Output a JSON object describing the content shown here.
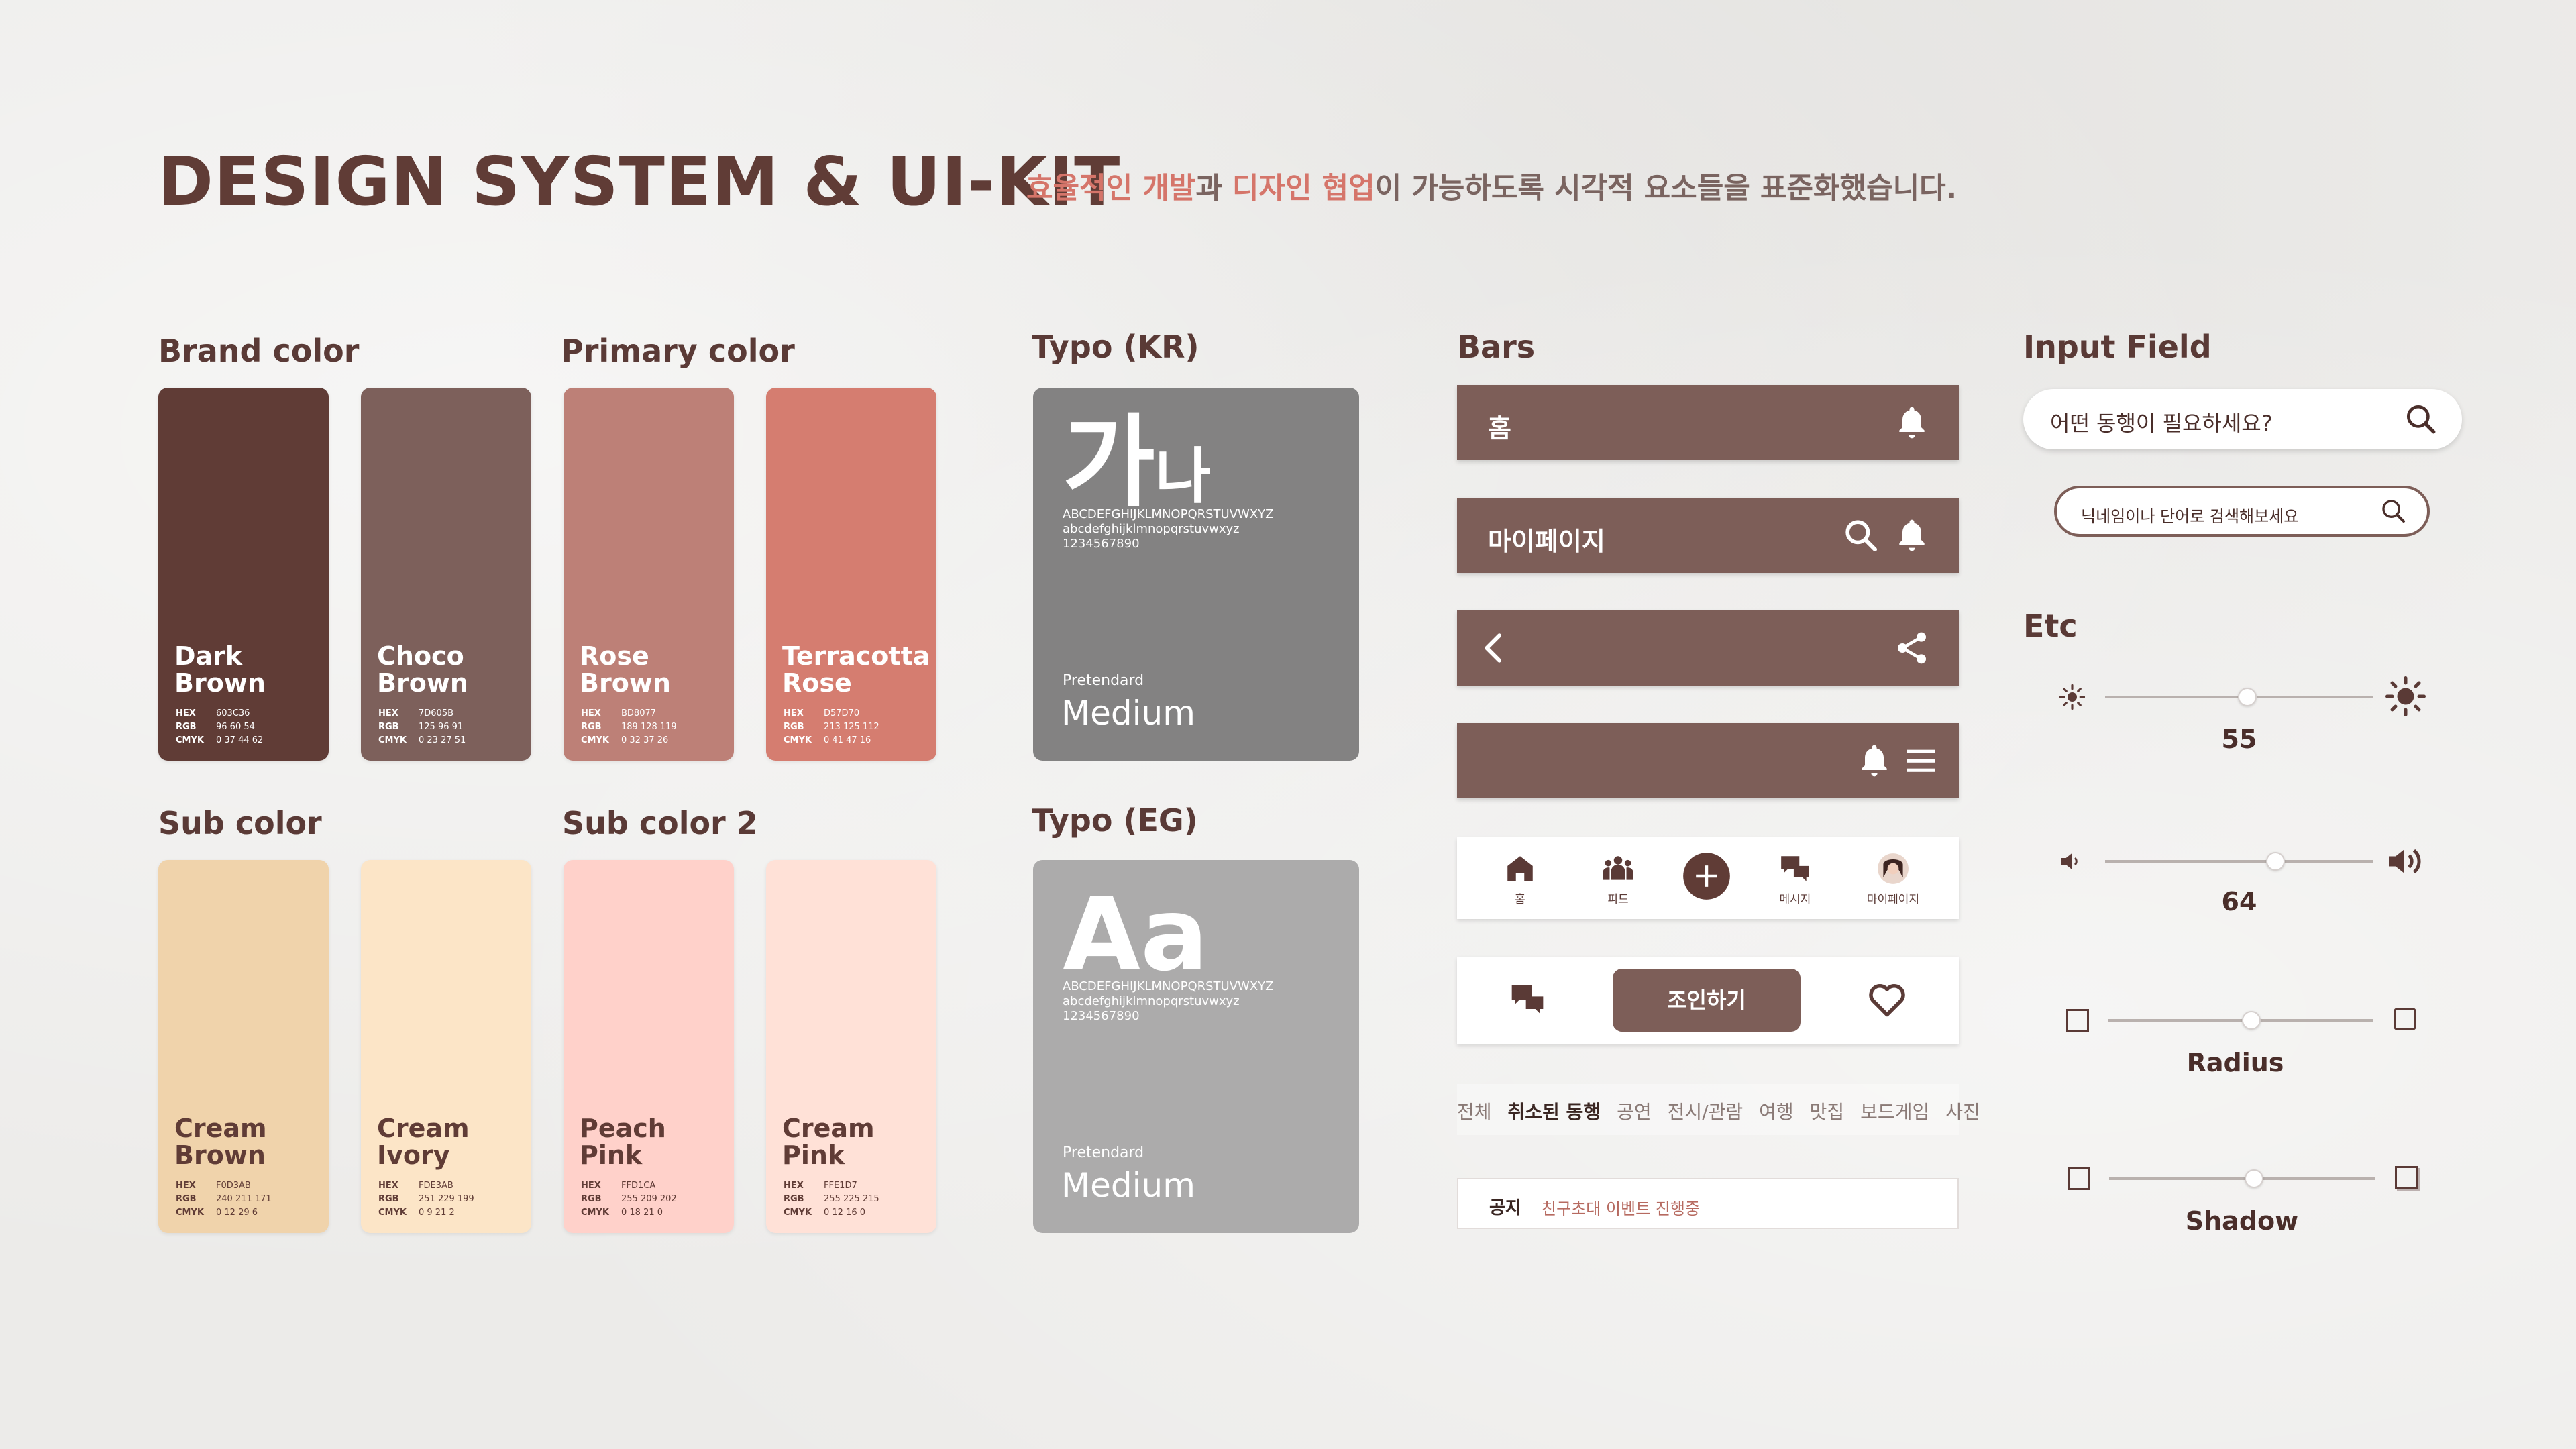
{
  "header": {
    "title": "DESIGN SYSTEM & UI-KIT",
    "tagline": {
      "hl1": "효율적인 개발",
      "t1": "과 ",
      "hl2": "디자인 협업",
      "t2": "이 가능하도록 시각적 요소들을 표준화했습니다."
    }
  },
  "colors": {
    "brand_label": "Brand color",
    "primary_label": "Primary color",
    "sub_label": "Sub color",
    "sub2_label": "Sub color 2",
    "swatches": [
      {
        "name": "Dark Brown",
        "hex": "603C36",
        "rgb": "96 60 54",
        "cmyk": "0 37 44 62",
        "color": "#603C36",
        "text": "#ffffff"
      },
      {
        "name": "Choco Brown",
        "hex": "7D605B",
        "rgb": "125 96 91",
        "cmyk": "0 23 27 51",
        "color": "#7D605B",
        "text": "#ffffff"
      },
      {
        "name": "Rose Brown",
        "hex": "BD8077",
        "rgb": "189 128 119",
        "cmyk": "0 32 37 26",
        "color": "#BD8077",
        "text": "#ffffff"
      },
      {
        "name": "Terracotta Rose",
        "hex": "D57D70",
        "rgb": "213 125 112",
        "cmyk": "0 41 47 16",
        "color": "#D57D70",
        "text": "#ffffff"
      },
      {
        "name": "Cream Brown",
        "hex": "F0D3AB",
        "rgb": "240 211 171",
        "cmyk": "0 12 29 6",
        "color": "#F0D3AB",
        "text": "#603C36"
      },
      {
        "name": "Cream Ivory",
        "hex": "FDE3AB",
        "rgb": "251 229 199",
        "cmyk": "0 9 21 2",
        "color": "#FCE5C7",
        "text": "#603C36"
      },
      {
        "name": "Peach Pink",
        "hex": "FFD1CA",
        "rgb": "255 209 202",
        "cmyk": "0 18 21 0",
        "color": "#FFD1CA",
        "text": "#603C36"
      },
      {
        "name": "Cream Pink",
        "hex": "FFE1D7",
        "rgb": "255 225 215",
        "cmyk": "0 12 16 0",
        "color": "#FFE1D7",
        "text": "#603C36"
      }
    ],
    "code_keys": {
      "hex": "HEX",
      "rgb": "RGB",
      "cmyk": "CMYK"
    }
  },
  "typo": {
    "kr_label": "Typo (KR)",
    "eg_label": "Typo (EG)",
    "kr_big": "가",
    "kr_small": "나",
    "eg_big": "Aa",
    "upper": "ABCDEFGHIJKLMNOPQRSTUVWXYZ",
    "lower": "abcdefghijklmnopqrstuvwxyz",
    "digits": "1234567890",
    "family": "Pretendard",
    "weight": "Medium"
  },
  "bars": {
    "label": "Bars",
    "home_title": "홈",
    "mypage_title": "마이페이지",
    "nav": [
      {
        "label": "홈"
      },
      {
        "label": "피드"
      },
      {
        "label": ""
      },
      {
        "label": "메시지"
      },
      {
        "label": "마이페이지"
      }
    ],
    "join_label": "조인하기",
    "tabs": [
      "전체",
      "취소된 동행",
      "공연",
      "전시/관람",
      "여행",
      "맛집",
      "보드게임",
      "사진"
    ],
    "notice_label": "공지",
    "notice_text": "친구초대 이벤트 진행중"
  },
  "inputs": {
    "label": "Input Field",
    "placeholder1": "어떤 동행이 필요하세요?",
    "placeholder2": "닉네임이나 단어로 검색해보세요"
  },
  "etc": {
    "label": "Etc",
    "brightness": 55,
    "volume": 64,
    "radius_label": "Radius",
    "shadow_label": "Shadow"
  }
}
